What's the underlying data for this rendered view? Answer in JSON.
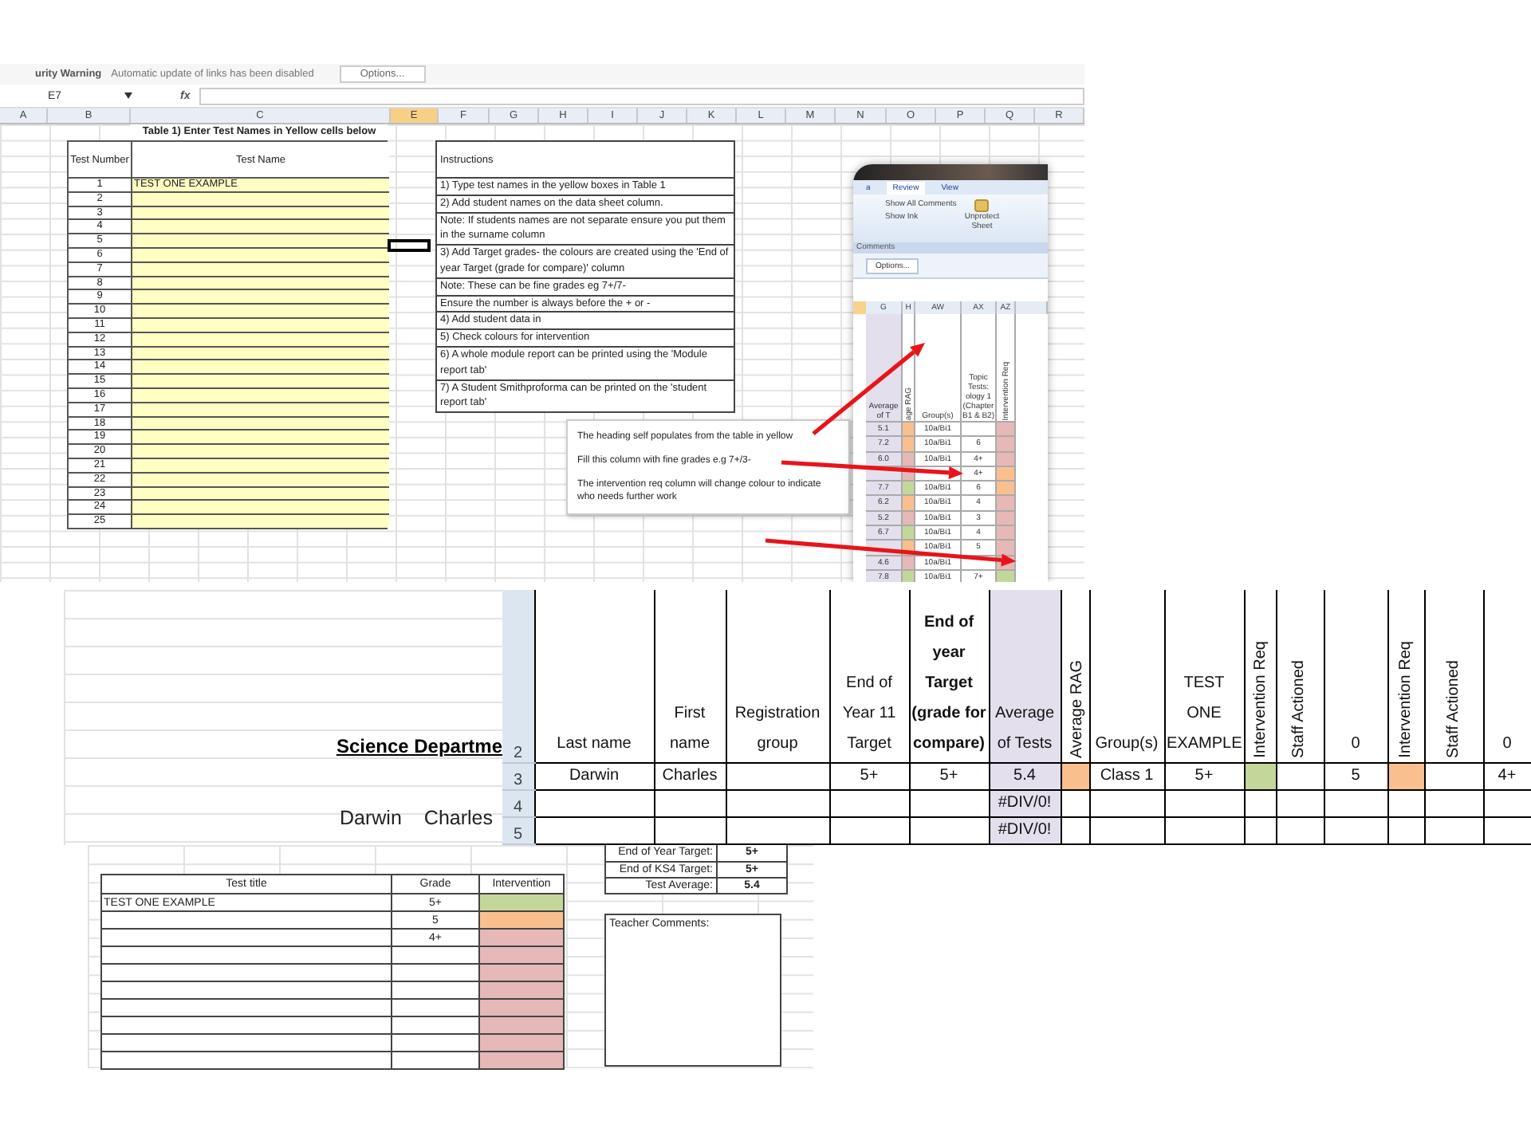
{
  "warning_bar": {
    "label": "urity Warning",
    "message": "Automatic update of links has been disabled",
    "button": "Options..."
  },
  "formula_bar": {
    "name_box": "E7",
    "function_label": "fx"
  },
  "sheet_columns": [
    {
      "letter": "A",
      "selected": false
    },
    {
      "letter": "B",
      "selected": false
    },
    {
      "letter": "C",
      "selected": false
    },
    {
      "letter": "E",
      "selected": true
    },
    {
      "letter": "F",
      "selected": false
    },
    {
      "letter": "G",
      "selected": false
    },
    {
      "letter": "H",
      "selected": false
    },
    {
      "letter": "I",
      "selected": false
    },
    {
      "letter": "J",
      "selected": false
    },
    {
      "letter": "K",
      "selected": false
    },
    {
      "letter": "L",
      "selected": false
    },
    {
      "letter": "M",
      "selected": false
    },
    {
      "letter": "N",
      "selected": false
    },
    {
      "letter": "O",
      "selected": false
    },
    {
      "letter": "P",
      "selected": false
    },
    {
      "letter": "Q",
      "selected": false
    },
    {
      "letter": "R",
      "selected": false
    }
  ],
  "table1": {
    "title": "Table 1) Enter Test Names in Yellow cells below",
    "columns": [
      "Test Number",
      "Test Name"
    ],
    "rows": [
      {
        "number": "1",
        "name": "TEST ONE EXAMPLE"
      },
      {
        "number": "2"
      },
      {
        "number": "3"
      },
      {
        "number": "4"
      },
      {
        "number": "5"
      },
      {
        "number": "6"
      },
      {
        "number": "7"
      },
      {
        "number": "8"
      },
      {
        "number": "9"
      },
      {
        "number": "10"
      },
      {
        "number": "11"
      },
      {
        "number": "12"
      },
      {
        "number": "13"
      },
      {
        "number": "14"
      },
      {
        "number": "15"
      },
      {
        "number": "16"
      },
      {
        "number": "17"
      },
      {
        "number": "18"
      },
      {
        "number": "19"
      },
      {
        "number": "20"
      },
      {
        "number": "21"
      },
      {
        "number": "22"
      },
      {
        "number": "23"
      },
      {
        "number": "24"
      },
      {
        "number": "25"
      }
    ]
  },
  "instructions": {
    "heading": "Instructions",
    "lines": [
      "1) Type test names in the yellow boxes in Table 1",
      "2) Add student names on the data sheet column.",
      "Note: If students names are not separate ensure you put them in the surname column",
      "3) Add Target grades- the colours are created using the 'End of year Target (grade for compare)' column",
      "Note: These can be fine grades eg 7+/7-",
      "Ensure the number is always before the + or -",
      "4) Add student data in",
      "5) Check colours for intervention",
      "6) A whole module report can be printed using the 'Module report tab'",
      "7) A Student Smithproforma can be printed on the 'student report tab'"
    ]
  },
  "callout": {
    "notes": [
      "The heading self populates  from the table in yellow",
      "Fill this column with fine grades e.g 7+/3-",
      "The intervention  req column will change colour to indicate who needs further  work"
    ]
  },
  "inset": {
    "tabs": [
      {
        "label": "a",
        "selected": false
      },
      {
        "label": "Review",
        "selected": true
      },
      {
        "label": "View",
        "selected": false
      }
    ],
    "ribbon_buttons": [
      "Show All Comments",
      "Show Ink"
    ],
    "big_button": "Unprotect Sheet",
    "group_label": "Comments",
    "options_button": "Options...",
    "columns": [
      "G",
      "H",
      "AW",
      "AX",
      "AZ"
    ],
    "headers": [
      "Average of T",
      "age RAG",
      "Group(s)",
      "Topic Tests: ology 1 (Chapter B1 & B2)",
      "Intervention Req"
    ],
    "rows": [
      {
        "average": "5.1",
        "rag": {
          "color": "#fabf8f"
        },
        "group": "10a/Bi1",
        "intervention": {
          "color": "#e6b8b7"
        }
      },
      {
        "average": "7.2",
        "rag": {
          "color": "#fabf8f"
        },
        "group": "10a/Bi1",
        "grade": "6",
        "intervention": {
          "color": "#e6b8b7"
        }
      },
      {
        "average": "6.0",
        "rag": {
          "color": "#e6b8b7"
        },
        "group": "10a/Bi1",
        "grade": "4+",
        "intervention": {
          "color": "#e6b8b7"
        }
      },
      {
        "rag": {
          "color": "#e6b8b7"
        },
        "grade": "4+",
        "intervention": {
          "color": "#fabf8f"
        }
      },
      {
        "average": "7.7",
        "rag": {
          "color": "#c4d79b"
        },
        "group": "10a/Bi1",
        "grade": "6",
        "intervention": {
          "color": "#fabf8f"
        }
      },
      {
        "average": "6.2",
        "rag": {
          "color": "#fabf8f"
        },
        "group": "10a/Bi1",
        "grade": "4",
        "intervention": {
          "color": "#e6b8b7"
        }
      },
      {
        "average": "5.2",
        "rag": {
          "color": "#e6b8b7"
        },
        "group": "10a/Bi1",
        "grade": "3",
        "intervention": {
          "color": "#e6b8b7"
        }
      },
      {
        "average": "6.7",
        "rag": {
          "color": "#c4d79b"
        },
        "group": "10a/Bi1",
        "grade": "4",
        "intervention": {
          "color": "#e6b8b7"
        }
      },
      {
        "rag": {
          "color": "#fabf8f"
        },
        "group": "10a/Bi1",
        "grade": "5",
        "intervention": {
          "color": "#e6b8b7"
        }
      },
      {
        "average": "4.6",
        "rag": {
          "color": "#e6b8b7"
        },
        "group": "10a/Bi1",
        "intervention": {
          "color": "#e6b8b7"
        }
      },
      {
        "average": "7.8",
        "rag": {
          "color": "#c4d79b"
        },
        "group": "10a/Bi1",
        "grade": "7+",
        "intervention": {
          "color": "#c4d79b"
        }
      }
    ]
  },
  "data_sheet": {
    "title": "Science Departme",
    "student_names": [
      "Darwin",
      "Charles"
    ],
    "header_row": "2",
    "columns": [
      {
        "label": "Last name",
        "vertical": false,
        "bold": false,
        "shaded": false
      },
      {
        "label": "First name",
        "vertical": false,
        "bold": false,
        "shaded": false
      },
      {
        "label": "Registration group",
        "vertical": false,
        "bold": false,
        "shaded": false
      },
      {
        "label": "End of Year 11 Target",
        "vertical": false,
        "bold": false,
        "shaded": false
      },
      {
        "label": "End of year Target (grade for compare)",
        "vertical": false,
        "bold": true,
        "shaded": false
      },
      {
        "label": "Average of Tests",
        "vertical": false,
        "bold": false,
        "shaded": true
      },
      {
        "label": "Average RAG",
        "vertical": true,
        "bold": false,
        "shaded": false
      },
      {
        "label": "Group(s)",
        "vertical": false,
        "bold": false,
        "shaded": false
      },
      {
        "label": "TEST ONE EXAMPLE",
        "vertical": false,
        "bold": false,
        "shaded": false
      },
      {
        "label": "Intervention Req",
        "vertical": true,
        "bold": false,
        "shaded": false
      },
      {
        "label": "Staff Actioned",
        "vertical": true,
        "bold": false,
        "shaded": false
      },
      {
        "label": "0",
        "vertical": false,
        "bold": false,
        "shaded": false
      },
      {
        "label": "Intervention Req",
        "vertical": true,
        "bold": false,
        "shaded": false
      },
      {
        "label": "Staff Actioned",
        "vertical": true,
        "bold": false,
        "shaded": false
      },
      {
        "label": "0",
        "vertical": false,
        "bold": false,
        "shaded": false
      }
    ],
    "rows": [
      {
        "number": "3",
        "cells": [
          {
            "text": "Darwin"
          },
          {
            "text": "Charles"
          },
          {},
          {
            "text": "5+"
          },
          {
            "text": "5+"
          },
          {
            "text": "5.4"
          },
          {
            "color": "#fabf8f"
          },
          {
            "text": "Class 1"
          },
          {
            "text": "5+"
          },
          {
            "color": "#c4d79b"
          },
          {},
          {
            "text": "5"
          },
          {
            "color": "#fabf8f"
          },
          {},
          {
            "text": "4+"
          }
        ]
      },
      {
        "number": "4",
        "cells": [
          {},
          {},
          {},
          {},
          {},
          {
            "text": "#DIV/0!"
          },
          {},
          {},
          {},
          {},
          {},
          {},
          {},
          {},
          {}
        ]
      },
      {
        "number": "5",
        "cells": [
          {},
          {},
          {},
          {},
          {},
          {
            "text": "#DIV/0!"
          },
          {},
          {},
          {},
          {},
          {},
          {},
          {},
          {},
          {}
        ]
      }
    ]
  },
  "report": {
    "columns": [
      "Test title",
      "Grade",
      "Intervention"
    ],
    "rows": [
      {
        "title": "TEST ONE EXAMPLE",
        "grade": "5+",
        "color": "#c4d79b"
      },
      {
        "grade": "5",
        "color": "#fabf8f"
      },
      {
        "grade": "4+",
        "color": "#e6b8b7"
      },
      {
        "color": "#e6b8b7"
      },
      {
        "color": "#e6b8b7"
      },
      {
        "color": "#e6b8b7"
      },
      {
        "color": "#e6b8b7"
      },
      {
        "color": "#e6b8b7"
      },
      {
        "color": "#e6b8b7"
      },
      {
        "color": "#e6b8b7"
      }
    ],
    "summary": [
      {
        "label": "End of Year Target:",
        "value": "5+"
      },
      {
        "label": "End of KS4 Target:",
        "value": "5+"
      },
      {
        "label": "Test Average:",
        "value": "5.4"
      }
    ],
    "comments_label": "Teacher Comments:"
  }
}
